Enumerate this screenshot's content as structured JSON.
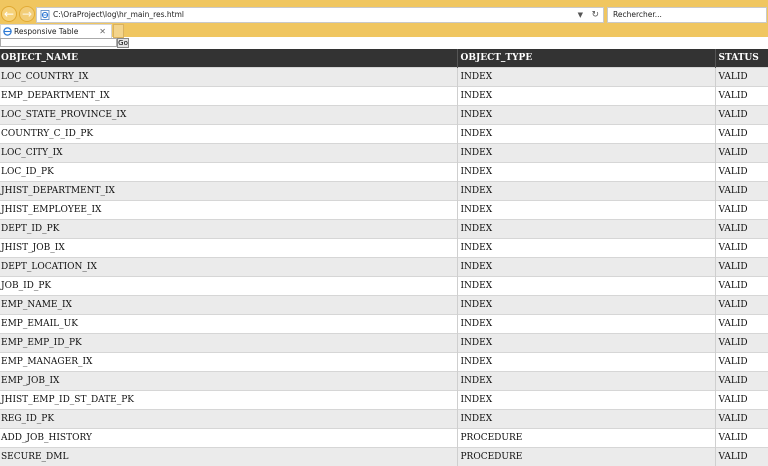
{
  "browser": {
    "address": "C:\\OraProject\\log\\hr_main_res.html",
    "search_placeholder": "Rechercher...",
    "tab_title": "Responsive Table"
  },
  "form": {
    "go_label": "Go"
  },
  "table": {
    "headers": [
      "OBJECT_NAME",
      "OBJECT_TYPE",
      "STATUS"
    ],
    "rows": [
      [
        "LOC_COUNTRY_IX",
        "INDEX",
        "VALID"
      ],
      [
        "EMP_DEPARTMENT_IX",
        "INDEX",
        "VALID"
      ],
      [
        "LOC_STATE_PROVINCE_IX",
        "INDEX",
        "VALID"
      ],
      [
        "COUNTRY_C_ID_PK",
        "INDEX",
        "VALID"
      ],
      [
        "LOC_CITY_IX",
        "INDEX",
        "VALID"
      ],
      [
        "LOC_ID_PK",
        "INDEX",
        "VALID"
      ],
      [
        "JHIST_DEPARTMENT_IX",
        "INDEX",
        "VALID"
      ],
      [
        "JHIST_EMPLOYEE_IX",
        "INDEX",
        "VALID"
      ],
      [
        "DEPT_ID_PK",
        "INDEX",
        "VALID"
      ],
      [
        "JHIST_JOB_IX",
        "INDEX",
        "VALID"
      ],
      [
        "DEPT_LOCATION_IX",
        "INDEX",
        "VALID"
      ],
      [
        "JOB_ID_PK",
        "INDEX",
        "VALID"
      ],
      [
        "EMP_NAME_IX",
        "INDEX",
        "VALID"
      ],
      [
        "EMP_EMAIL_UK",
        "INDEX",
        "VALID"
      ],
      [
        "EMP_EMP_ID_PK",
        "INDEX",
        "VALID"
      ],
      [
        "EMP_MANAGER_IX",
        "INDEX",
        "VALID"
      ],
      [
        "EMP_JOB_IX",
        "INDEX",
        "VALID"
      ],
      [
        "JHIST_EMP_ID_ST_DATE_PK",
        "INDEX",
        "VALID"
      ],
      [
        "REG_ID_PK",
        "INDEX",
        "VALID"
      ],
      [
        "ADD_JOB_HISTORY",
        "PROCEDURE",
        "VALID"
      ],
      [
        "SECURE_DML",
        "PROCEDURE",
        "VALID"
      ]
    ]
  },
  "icons": {
    "back": "back-arrow-icon",
    "forward": "forward-arrow-icon",
    "page": "ie-page-icon",
    "dropdown": "dropdown-arrow-icon",
    "refresh": "refresh-icon",
    "close": "close-icon"
  },
  "colors": {
    "chrome": "#f0c660",
    "header_bg": "#333333",
    "row_alt": "#ebebeb"
  }
}
